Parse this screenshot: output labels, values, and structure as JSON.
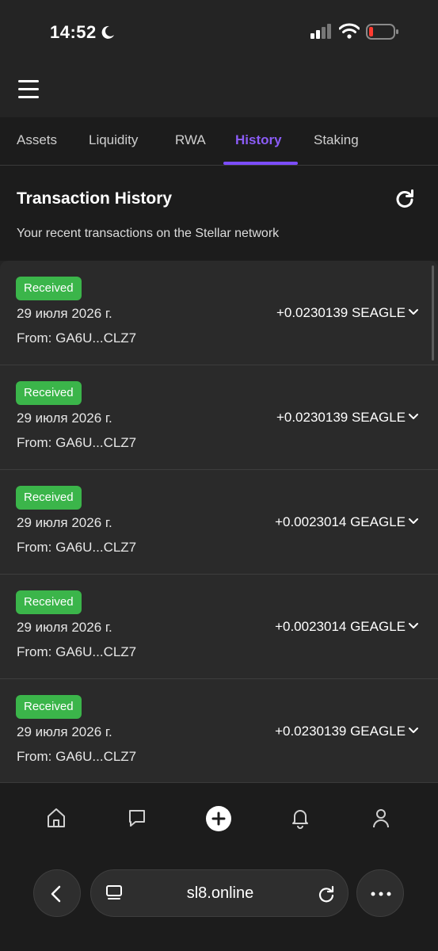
{
  "status_bar": {
    "time": "14:52"
  },
  "tabs": [
    {
      "label": "Assets",
      "active": false
    },
    {
      "label": "Liquidity",
      "active": false
    },
    {
      "label": "RWA",
      "active": false
    },
    {
      "label": "History",
      "active": true
    },
    {
      "label": "Staking",
      "active": false
    }
  ],
  "history": {
    "title": "Transaction History",
    "subtitle": "Your recent transactions on the Stellar network"
  },
  "transactions": [
    {
      "status": "Received",
      "date": "29 июля 2026 г.",
      "from": "From: GA6U...CLZ7",
      "amount": "+0.0230139 SEAGLE"
    },
    {
      "status": "Received",
      "date": "29 июля 2026 г.",
      "from": "From: GA6U...CLZ7",
      "amount": "+0.0230139 SEAGLE"
    },
    {
      "status": "Received",
      "date": "29 июля 2026 г.",
      "from": "From: GA6U...CLZ7",
      "amount": "+0.0023014 GEAGLE"
    },
    {
      "status": "Received",
      "date": "29 июля 2026 г.",
      "from": "From: GA6U...CLZ7",
      "amount": "+0.0023014 GEAGLE"
    },
    {
      "status": "Received",
      "date": "29 июля 2026 г.",
      "from": "From: GA6U...CLZ7",
      "amount": "+0.0230139 GEAGLE"
    }
  ],
  "bottom_nav": [
    "home-icon",
    "chat-icon",
    "plus-icon",
    "bell-icon",
    "profile-icon"
  ],
  "browser": {
    "url": "sl8.online"
  },
  "colors": {
    "accent": "#8b5cf6",
    "badge_green": "#3bb54a",
    "background": "#242424"
  }
}
